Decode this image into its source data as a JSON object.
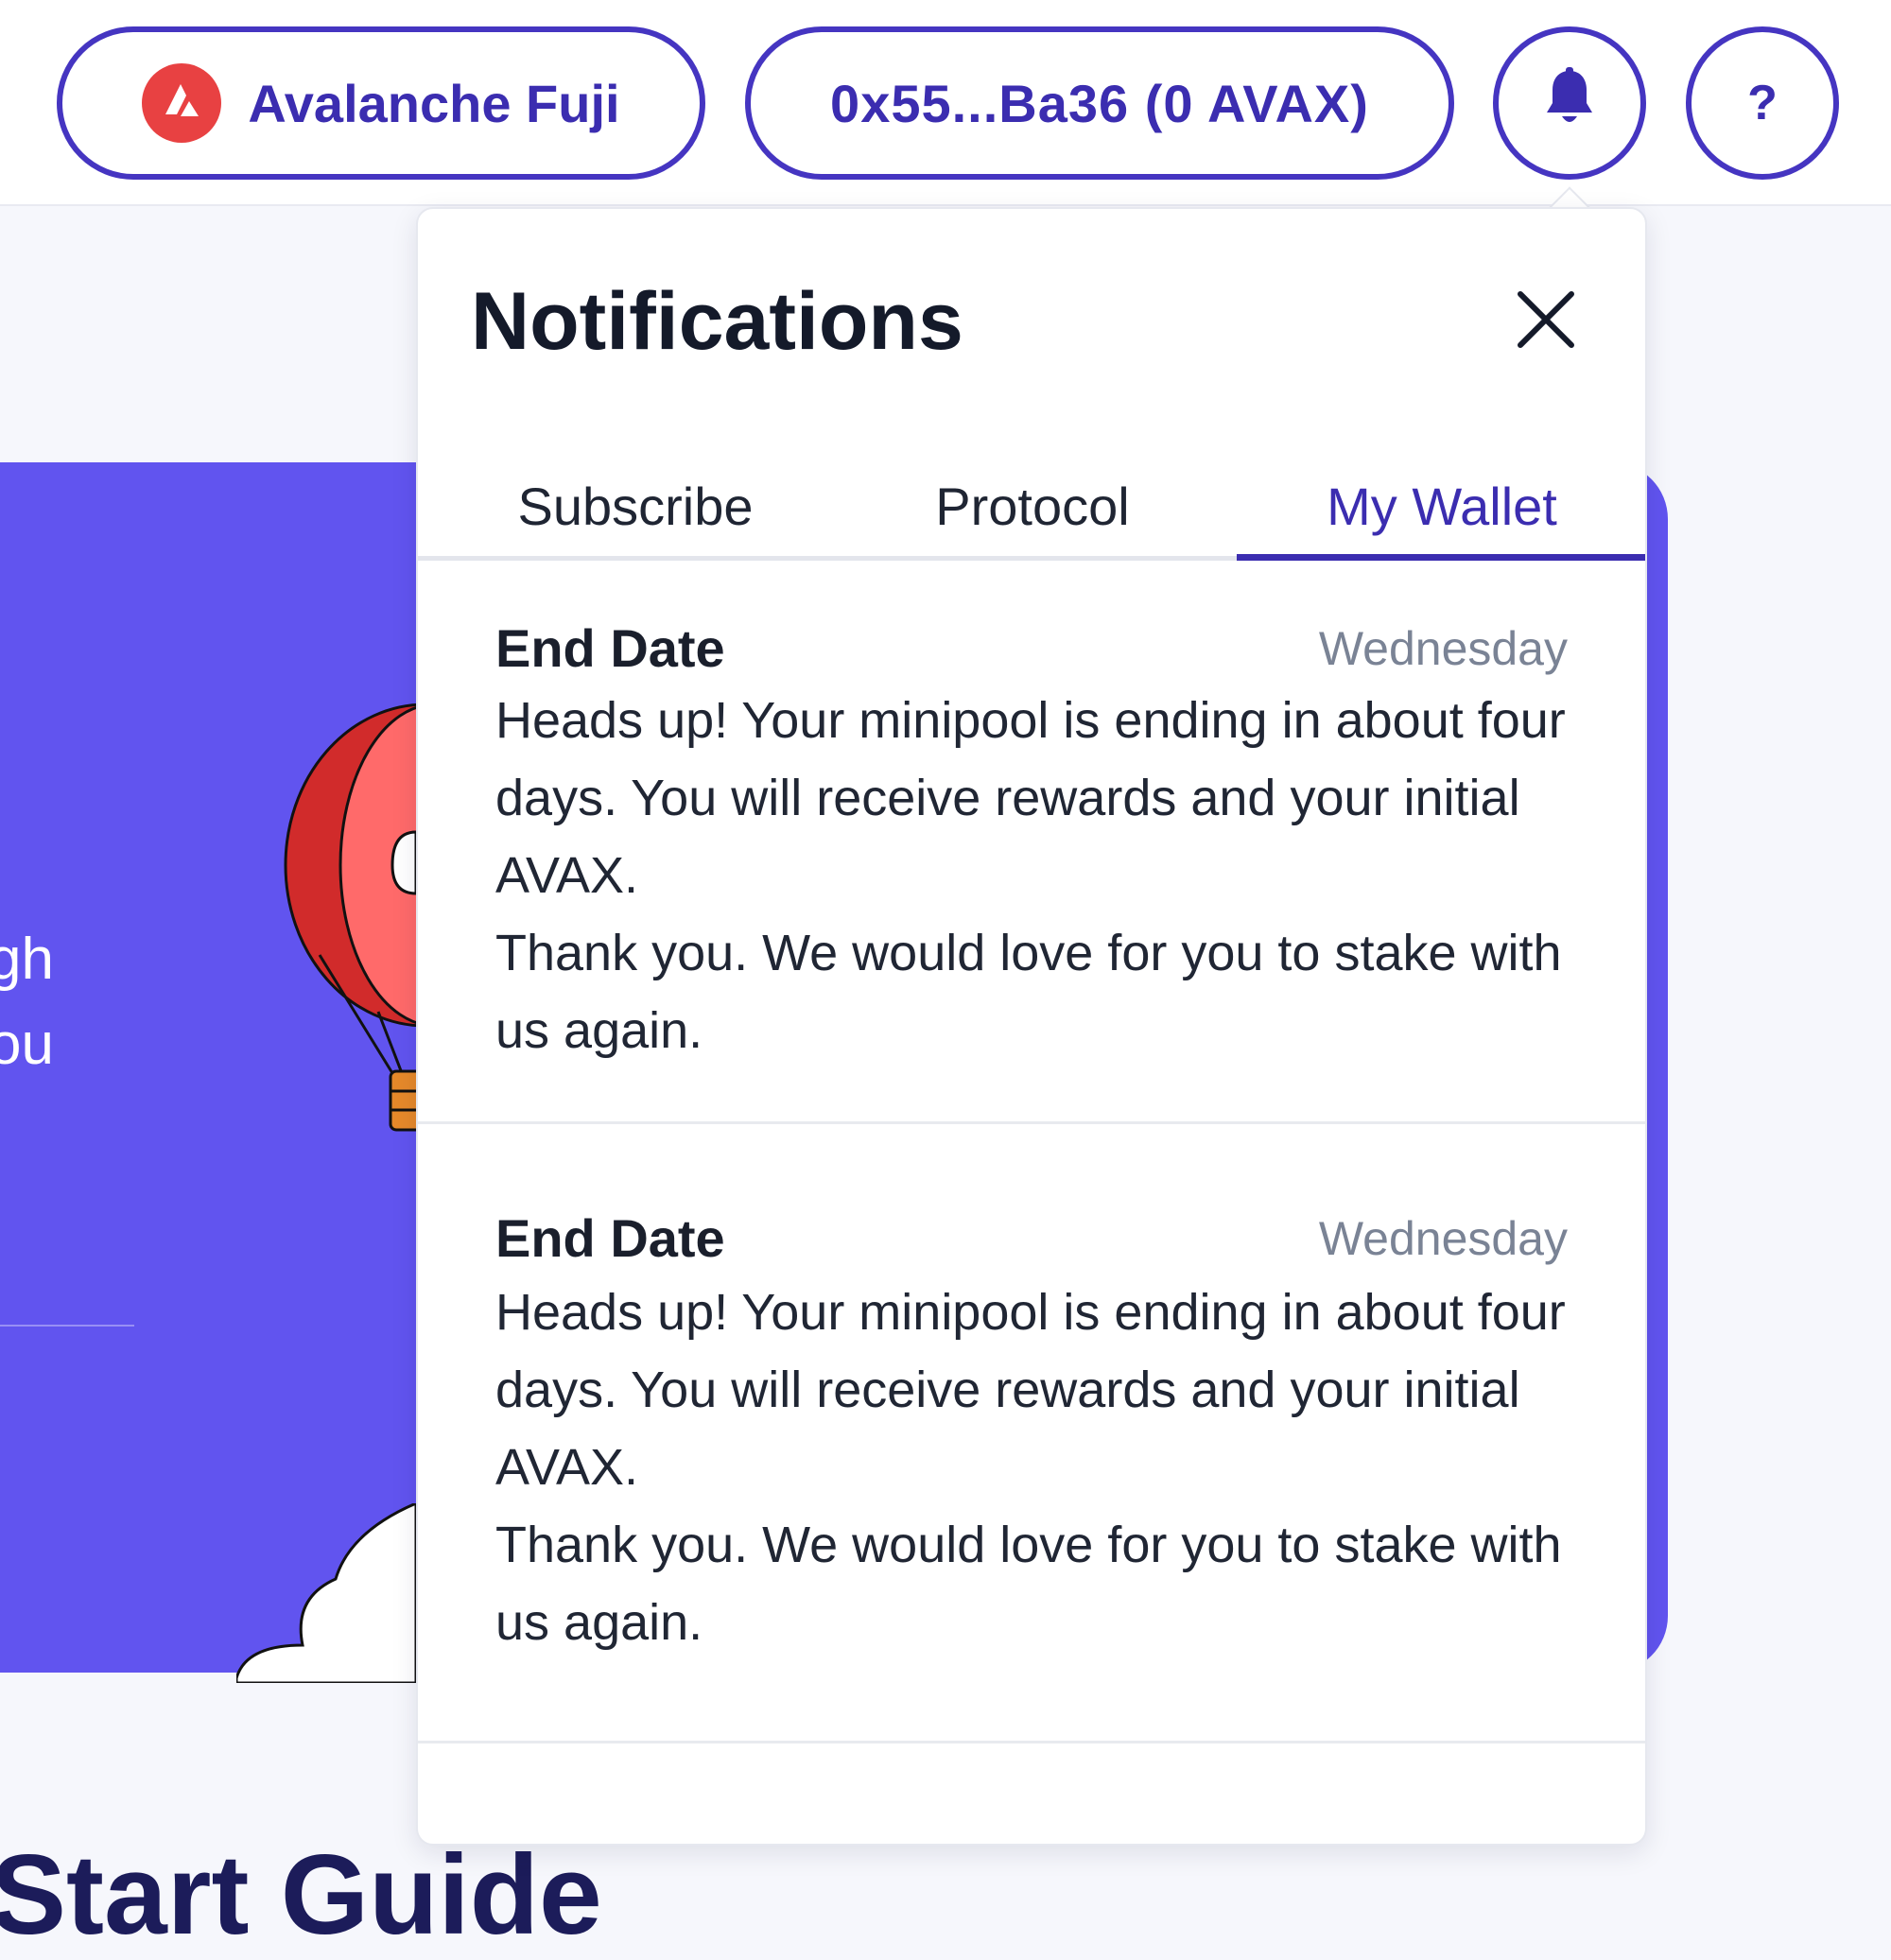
{
  "header": {
    "network_label": "Avalanche Fuji",
    "wallet_label": "0x55...Ba36 (0 AVAX)",
    "help_label": "?",
    "icons": {
      "network": "avalanche-logo-icon",
      "bell": "bell-icon"
    },
    "colors": {
      "accent": "#3b2db0",
      "brand_red": "#e84142"
    }
  },
  "hero": {
    "text_line1": "gh",
    "text_line2": "ou",
    "color": "#6154ef"
  },
  "page": {
    "guide_title_partial": "Start Guide"
  },
  "notifications": {
    "title": "Notifications",
    "close_icon": "close-icon",
    "tabs": [
      {
        "label": "Subscribe",
        "active": false
      },
      {
        "label": "Protocol",
        "active": false
      },
      {
        "label": "My Wallet",
        "active": true
      }
    ],
    "items": [
      {
        "title": "End Date",
        "date": "Wednesday",
        "body_line1": "Heads up! Your minipool is ending in about four days. You will receive rewards and your initial AVAX.",
        "body_line2": "Thank you. We would love for you to stake with us again."
      },
      {
        "title": "End Date",
        "date": "Wednesday",
        "body_line1": "Heads up! Your minipool is ending in about four days. You will receive rewards and your initial AVAX.",
        "body_line2": "Thank you. We would love for you to stake with us again."
      }
    ]
  }
}
